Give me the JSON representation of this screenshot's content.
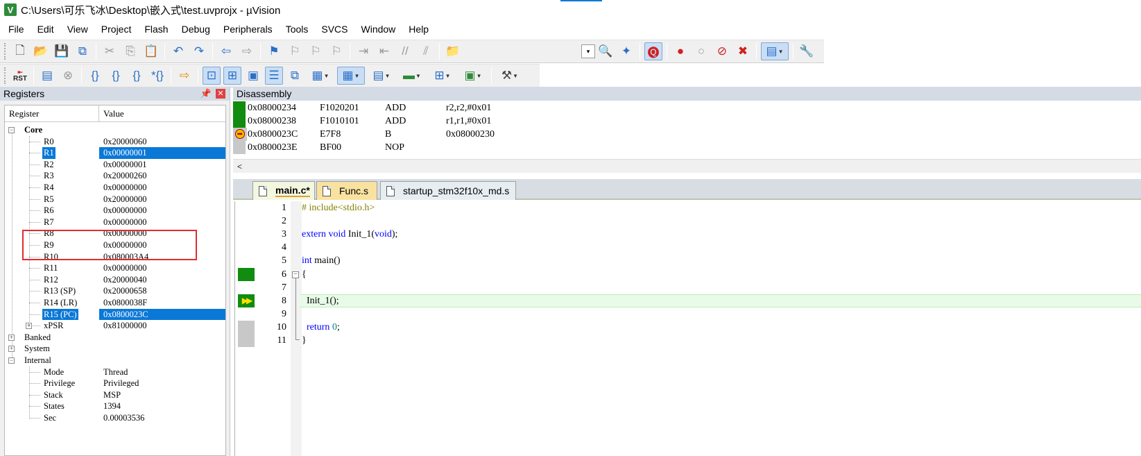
{
  "window": {
    "title": "C:\\Users\\可乐飞冰\\Desktop\\嵌入式\\test.uvprojx - µVision",
    "app_icon": "uvision-icon"
  },
  "menu": [
    "File",
    "Edit",
    "View",
    "Project",
    "Flash",
    "Debug",
    "Peripherals",
    "Tools",
    "SVCS",
    "Window",
    "Help"
  ],
  "toolbar2": {
    "rst_label": "RST"
  },
  "registers": {
    "title": "Registers",
    "columns": [
      "Register",
      "Value"
    ],
    "groups": {
      "core": "Core",
      "banked": "Banked",
      "system": "System",
      "internal": "Internal"
    },
    "core": [
      {
        "name": "R0",
        "value": "0x20000060"
      },
      {
        "name": "R1",
        "value": "0x00000001"
      },
      {
        "name": "R2",
        "value": "0x00000001"
      },
      {
        "name": "R3",
        "value": "0x20000260"
      },
      {
        "name": "R4",
        "value": "0x00000000"
      },
      {
        "name": "R5",
        "value": "0x20000000"
      },
      {
        "name": "R6",
        "value": "0x00000000"
      },
      {
        "name": "R7",
        "value": "0x00000000"
      },
      {
        "name": "R8",
        "value": "0x00000000"
      },
      {
        "name": "R9",
        "value": "0x00000000"
      },
      {
        "name": "R10",
        "value": "0x080003A4"
      },
      {
        "name": "R11",
        "value": "0x00000000"
      },
      {
        "name": "R12",
        "value": "0x20000040"
      },
      {
        "name": "R13 (SP)",
        "value": "0x20000658"
      },
      {
        "name": "R14 (LR)",
        "value": "0x0800038F"
      },
      {
        "name": "R15 (PC)",
        "value": "0x0800023C"
      },
      {
        "name": "xPSR",
        "value": "0x81000000"
      }
    ],
    "internal": [
      {
        "name": "Mode",
        "value": "Thread"
      },
      {
        "name": "Privilege",
        "value": "Privileged"
      },
      {
        "name": "Stack",
        "value": "MSP"
      },
      {
        "name": "States",
        "value": "1394"
      },
      {
        "name": "Sec",
        "value": "0.00003536"
      }
    ]
  },
  "disassembly": {
    "title": "Disassembly",
    "lines": [
      {
        "addr": "0x08000234",
        "code": "F1020201",
        "mnemonic": "ADD",
        "operands": "r2,r2,#0x01"
      },
      {
        "addr": "0x08000238",
        "code": "F1010101",
        "mnemonic": "ADD",
        "operands": "r1,r1,#0x01"
      },
      {
        "addr": "0x0800023C",
        "code": "E7F8",
        "mnemonic": "B",
        "operands": "0x08000230"
      },
      {
        "addr": "0x0800023E",
        "code": "BF00",
        "mnemonic": "NOP",
        "operands": ""
      }
    ],
    "scroll_left": "<"
  },
  "tabs": [
    {
      "label": "main.c*"
    },
    {
      "label": "Func.s"
    },
    {
      "label": "startup_stm32f10x_md.s"
    }
  ],
  "editor": {
    "lines": [
      {
        "n": "1",
        "parts": [
          {
            "t": "# include<stdio.h>",
            "c": "pp"
          }
        ]
      },
      {
        "n": "2",
        "parts": []
      },
      {
        "n": "3",
        "parts": [
          {
            "t": "extern void",
            "c": "kw"
          },
          {
            "t": " Init_1(",
            "c": ""
          },
          {
            "t": "void",
            "c": "kw"
          },
          {
            "t": ");",
            "c": ""
          }
        ]
      },
      {
        "n": "4",
        "parts": []
      },
      {
        "n": "5",
        "parts": [
          {
            "t": "int",
            "c": "kw"
          },
          {
            "t": " main()",
            "c": ""
          }
        ]
      },
      {
        "n": "6",
        "parts": [
          {
            "t": "{",
            "c": ""
          }
        ]
      },
      {
        "n": "7",
        "parts": []
      },
      {
        "n": "8",
        "parts": [
          {
            "t": "  Init_1();",
            "c": ""
          }
        ]
      },
      {
        "n": "9",
        "parts": []
      },
      {
        "n": "10",
        "parts": [
          {
            "t": "  ",
            "c": ""
          },
          {
            "t": "return",
            "c": "kw"
          },
          {
            "t": " ",
            "c": ""
          },
          {
            "t": "0",
            "c": "num"
          },
          {
            "t": ";",
            "c": ""
          }
        ]
      },
      {
        "n": "11",
        "parts": [
          {
            "t": "}",
            "c": ""
          }
        ]
      }
    ]
  },
  "colors": {
    "selection": "#0a78d7",
    "coverage_green": "#108c10",
    "highlight_box": "#e02c2c",
    "panel_header": "#d4dbe5"
  }
}
